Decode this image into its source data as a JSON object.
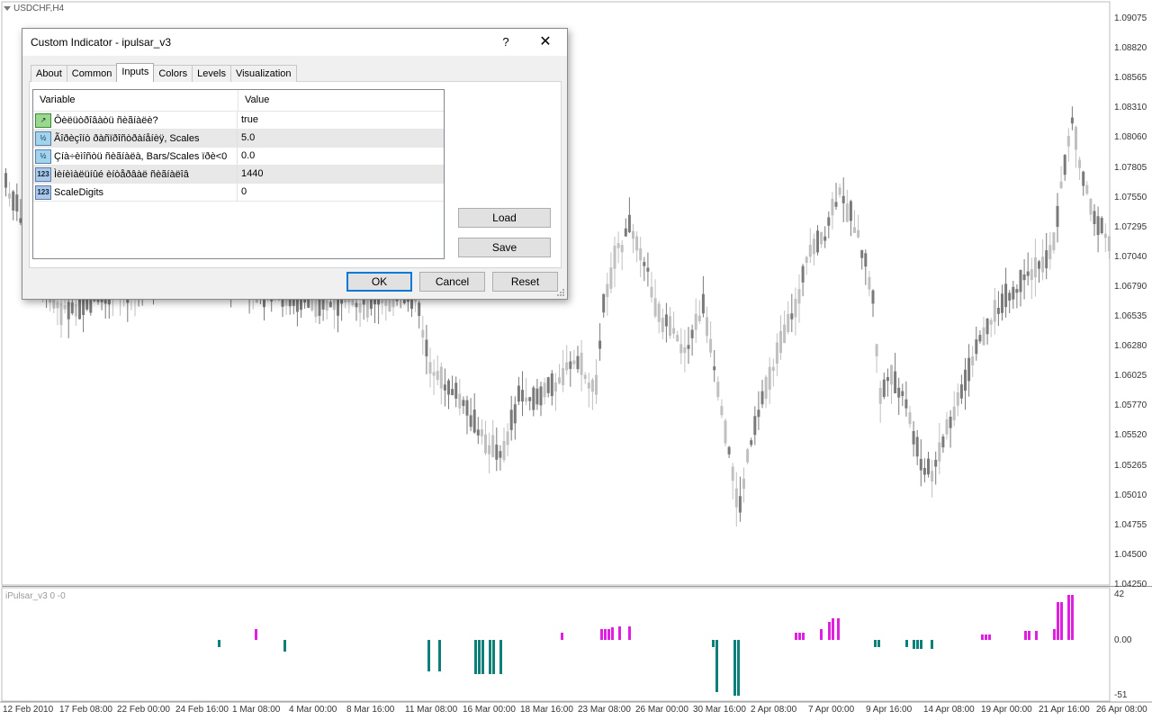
{
  "chart": {
    "symbol": "USDCHF,H4",
    "indicator_label": "iPulsar_v3 0 -0",
    "price_labels": [
      "1.09075",
      "1.08820",
      "1.08565",
      "1.08310",
      "1.08060",
      "1.07805",
      "1.07550",
      "1.07295",
      "1.07040",
      "1.06790",
      "1.06535",
      "1.06280",
      "1.06025",
      "1.05770",
      "1.05520",
      "1.05265",
      "1.05010",
      "1.04755",
      "1.04500",
      "1.04250"
    ],
    "indicator_scale": [
      "42",
      "0.00",
      "-51"
    ],
    "time_labels": [
      "12 Feb 2010",
      "17 Feb 08:00",
      "22 Feb 00:00",
      "24 Feb 16:00",
      "1 Mar 08:00",
      "4 Mar 00:00",
      "8 Mar 16:00",
      "11 Mar 08:00",
      "16 Mar 00:00",
      "18 Mar 16:00",
      "23 Mar 08:00",
      "26 Mar 00:00",
      "30 Mar 16:00",
      "2 Apr 08:00",
      "7 Apr 00:00",
      "9 Apr 16:00",
      "14 Apr 08:00",
      "19 Apr 00:00",
      "21 Apr 16:00",
      "26 Apr 08:00"
    ],
    "colors": {
      "bull": "#c0c0c0",
      "bear": "#7a7a7a",
      "pos_hist": "#e020e0",
      "neg_hist": "#0f7f7a",
      "grid": "#c8c8c8"
    }
  },
  "dialog": {
    "title": "Custom Indicator - ipulsar_v3",
    "help": "?",
    "close": "✕",
    "tabs": [
      "About",
      "Common",
      "Inputs",
      "Colors",
      "Levels",
      "Visualization"
    ],
    "active_tab": "Inputs",
    "grid_headers": {
      "variable": "Variable",
      "value": "Value"
    },
    "params": [
      {
        "icon": "bool-icon",
        "icon_text": "",
        "name": "Ôèëüòðîâàòü ñèãíàëè?",
        "value": "true"
      },
      {
        "icon": "double-icon",
        "icon_text": "½",
        "name": "Ãîðèçîíò ðàñïðîñòðàíåíèÿ, Scales",
        "value": "5.0"
      },
      {
        "icon": "double-icon",
        "icon_text": "½",
        "name": "Çíà÷èìîñòü ñèãíàëà, Bars/Scales ïðè<0",
        "value": "0.0"
      },
      {
        "icon": "int-icon",
        "icon_text": "123",
        "name": "Ìèíèìàëüíûé èíòåðâàë ñèãíàëîâ",
        "value": "1440"
      },
      {
        "icon": "int-icon",
        "icon_text": "123",
        "name": "ScaleDigits",
        "value": "0"
      }
    ],
    "load_label": "Load",
    "save_label": "Save",
    "ok_label": "OK",
    "cancel_label": "Cancel",
    "reset_label": "Reset"
  }
}
